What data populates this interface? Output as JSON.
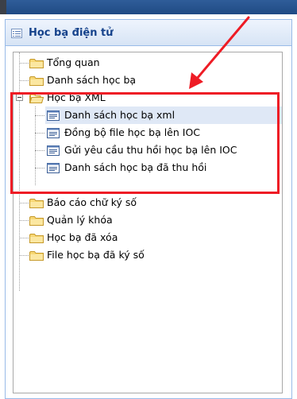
{
  "panel": {
    "title": "Học bạ điện tử"
  },
  "tree": {
    "items": [
      {
        "label": "Tổng quan",
        "icon": "folder-icon"
      },
      {
        "label": "Danh sách học bạ",
        "icon": "folder-icon"
      },
      {
        "label": "Học bạ XML",
        "icon": "folder-open-icon",
        "expanded": true,
        "children": [
          {
            "label": "Danh sách học bạ xml",
            "icon": "document-list-icon",
            "selected": true
          },
          {
            "label": "Đồng bộ file học bạ lên IOC",
            "icon": "document-list-icon"
          },
          {
            "label": "Gửi yêu cầu thu hồi học bạ lên IOC",
            "icon": "document-list-icon"
          },
          {
            "label": "Danh sách học bạ đã thu hồi",
            "icon": "document-list-icon"
          }
        ]
      },
      {
        "label": "Báo cáo chữ ký số",
        "icon": "folder-icon"
      },
      {
        "label": "Quản lý khóa",
        "icon": "folder-icon"
      },
      {
        "label": "Học bạ đã xóa",
        "icon": "folder-icon"
      },
      {
        "label": "File học bạ đã ký số",
        "icon": "folder-icon"
      }
    ]
  },
  "annotation": {
    "highlight_color": "#ee1c25",
    "arrow_color": "#ee1c25"
  }
}
